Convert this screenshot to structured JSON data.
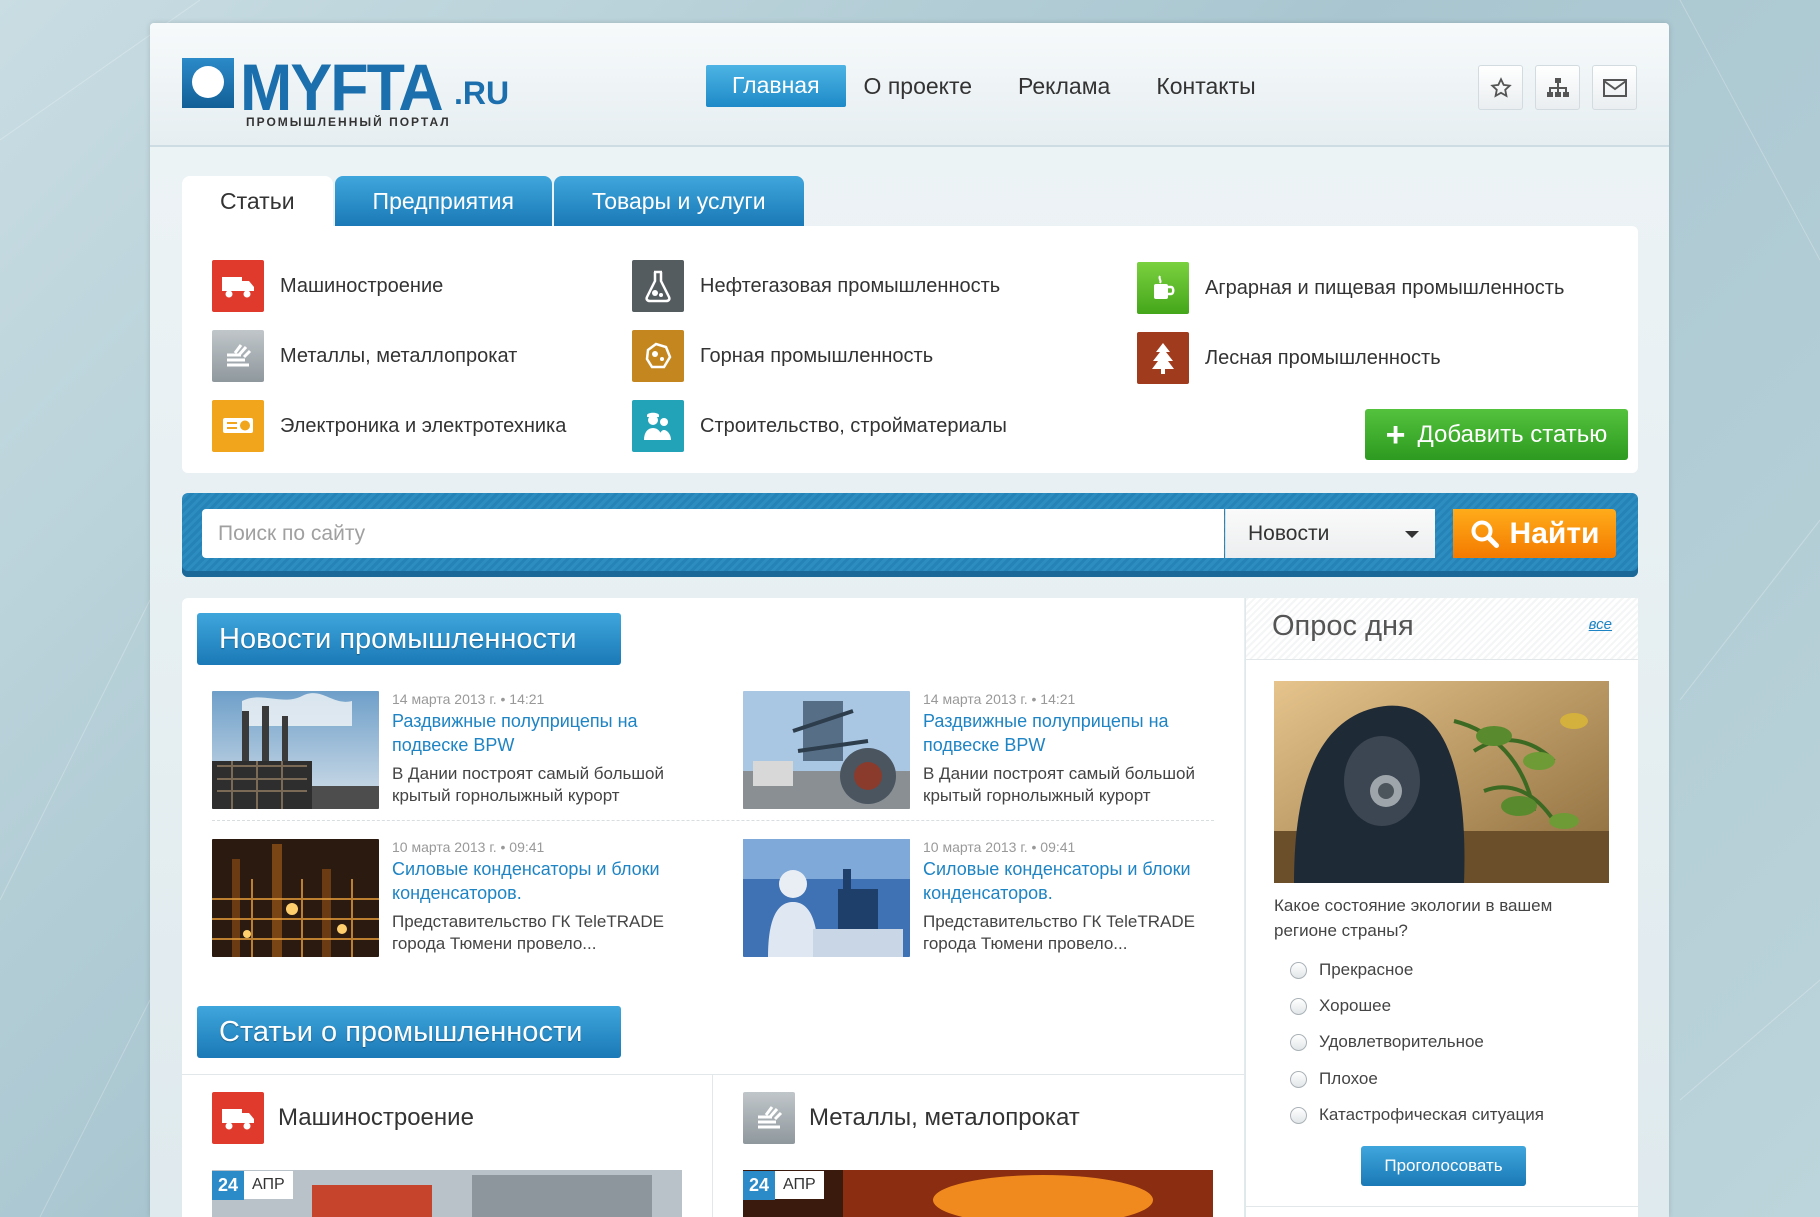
{
  "brand": {
    "logo_text": "MYFTA",
    "logo_tld": ".RU",
    "tagline": "ПРОМЫШЛЕННЫЙ ПОРТАЛ"
  },
  "nav": {
    "items": [
      "Главная",
      "О проекте",
      "Реклама",
      "Контакты"
    ],
    "active_index": 0
  },
  "header_icons": [
    "star-icon",
    "sitemap-icon",
    "mail-icon"
  ],
  "tabs": [
    "Статьи",
    "Предприятия",
    "Товары и услуги"
  ],
  "categories": [
    {
      "label": "Машиностроение",
      "icon": "truck-icon",
      "color": "#e03a2c"
    },
    {
      "label": "Металлы, металлопрокат",
      "icon": "metal-icon",
      "color": "#9aa3a8"
    },
    {
      "label": "Электроника и электротехника",
      "icon": "projector-icon",
      "color": "#f0a51c"
    },
    {
      "label": "Нефтегазовая промышленность",
      "icon": "flask-icon",
      "color": "#555c60"
    },
    {
      "label": "Горная промышленность",
      "icon": "ore-icon",
      "color": "#c48720"
    },
    {
      "label": "Строительство, стройматериалы",
      "icon": "builders-icon",
      "color": "#22a3b8"
    },
    {
      "label": "Аграрная и пищевая промышленность",
      "icon": "cup-icon",
      "color": "#5fbf2a"
    },
    {
      "label": "Лесная промышленность",
      "icon": "tree-icon",
      "color": "#a13b1e"
    }
  ],
  "add_article": {
    "label": "Добавить статью"
  },
  "search": {
    "placeholder": "Поиск по сайту",
    "select_value": "Новости",
    "button_label": "Найти"
  },
  "news": {
    "section_title": "Новости промышленности",
    "items": [
      {
        "date": "14 марта 2013 г. • 14:21",
        "title": "Раздвижные полуприцепы на подвеске BPW",
        "desc": "В Дании построят самый большой крытый горнолыжный курорт"
      },
      {
        "date": "14 марта 2013 г. • 14:21",
        "title": "Раздвижные полуприцепы на подвеске BPW",
        "desc": "В Дании построят самый большой крытый горнолыжный курорт"
      },
      {
        "date": "10 марта 2013 г. • 09:41",
        "title": "Силовые конденсаторы и блоки конденсаторов.",
        "desc": "Представительство ГК TeleTRADE города Тюмени провело..."
      },
      {
        "date": "10 марта 2013 г. • 09:41",
        "title": "Силовые конденсаторы и блоки конденсаторов.",
        "desc": "Представительство ГК TeleTRADE города Тюмени провело..."
      }
    ]
  },
  "articles": {
    "section_title": "Статьи о промышленности",
    "columns": [
      {
        "title": "Машиностроение",
        "icon": "truck-icon",
        "day": "24",
        "month": "АПР"
      },
      {
        "title": "Металлы, металопрокат",
        "icon": "metal-icon",
        "day": "24",
        "month": "АПР"
      }
    ]
  },
  "poll": {
    "title": "Опрос дня",
    "all_link": "все",
    "question": "Какое состояние экологии в вашем регионе страны?",
    "options": [
      "Прекрасное",
      "Хорошее",
      "Удовлетворительное",
      "Плохое",
      "Катастрофическая ситуация"
    ],
    "vote_label": "Проголосовать"
  },
  "colors": {
    "accent_blue": "#1e84c4",
    "search_orange": "#f47a00",
    "add_green": "#2d9a20"
  }
}
